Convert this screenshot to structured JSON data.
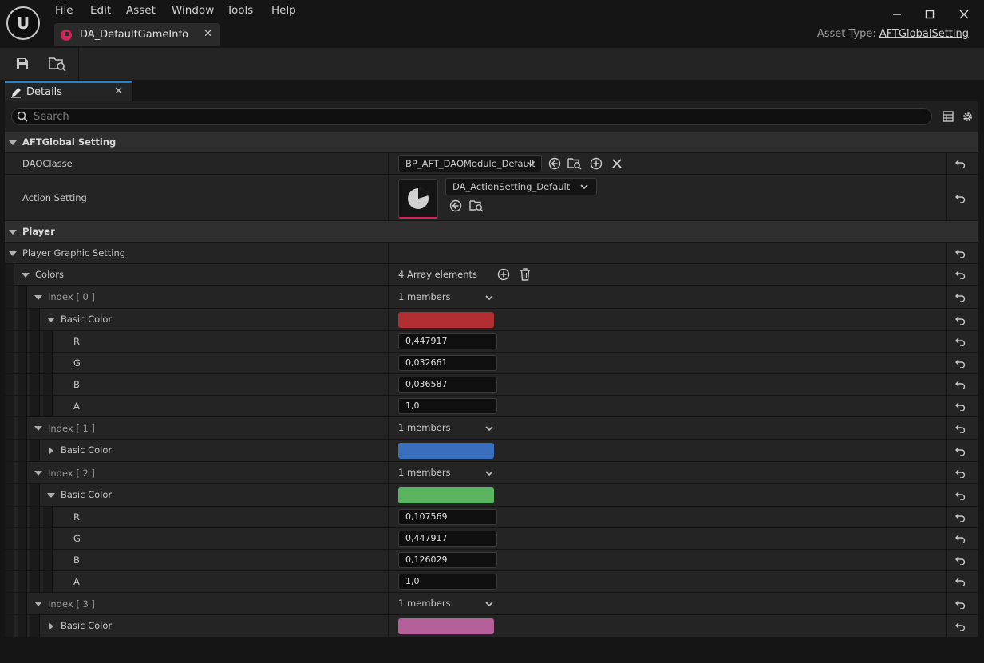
{
  "app": {
    "logo_text": "U",
    "menu": [
      "File",
      "Edit",
      "Asset",
      "Window",
      "Tools",
      "Help"
    ],
    "tab_title": "DA_DefaultGameInfo",
    "asset_type_label": "Asset Type:",
    "asset_type_value": "AFTGlobalSetting"
  },
  "details": {
    "tab_label": "Details",
    "search_placeholder": "Search"
  },
  "sections": {
    "aftglobal": "AFTGlobal Setting",
    "dao_label": "DAOClasse",
    "dao_value": "BP_AFT_DAOModule_Default",
    "action_label": "Action Setting",
    "action_value": "DA_ActionSetting_Default",
    "player": "Player",
    "player_graphic": "Player Graphic Setting",
    "colors": "Colors",
    "colors_count": "4 Array elements"
  },
  "colors": [
    {
      "index": "Index [ 0 ]",
      "members": "1 members",
      "basic": "Basic Color",
      "hex": "#b12f33",
      "expanded": true,
      "r": "0,447917",
      "g": "0,032661",
      "b": "0,036587",
      "a": "1,0"
    },
    {
      "index": "Index [ 1 ]",
      "members": "1 members",
      "basic": "Basic Color",
      "hex": "#3a6fbd",
      "expanded": false
    },
    {
      "index": "Index [ 2 ]",
      "members": "1 members",
      "basic": "Basic Color",
      "hex": "#5bb560",
      "expanded": true,
      "r": "0,107569",
      "g": "0,447917",
      "b": "0,126029",
      "a": "1,0"
    },
    {
      "index": "Index [ 3 ]",
      "members": "1 members",
      "basic": "Basic Color",
      "hex": "#b5609a",
      "expanded": false
    }
  ],
  "channel_labels": {
    "r": "R",
    "g": "G",
    "b": "B",
    "a": "A"
  },
  "theme": {
    "accent": "#2680c8",
    "tab_icon": "#d0265a"
  }
}
